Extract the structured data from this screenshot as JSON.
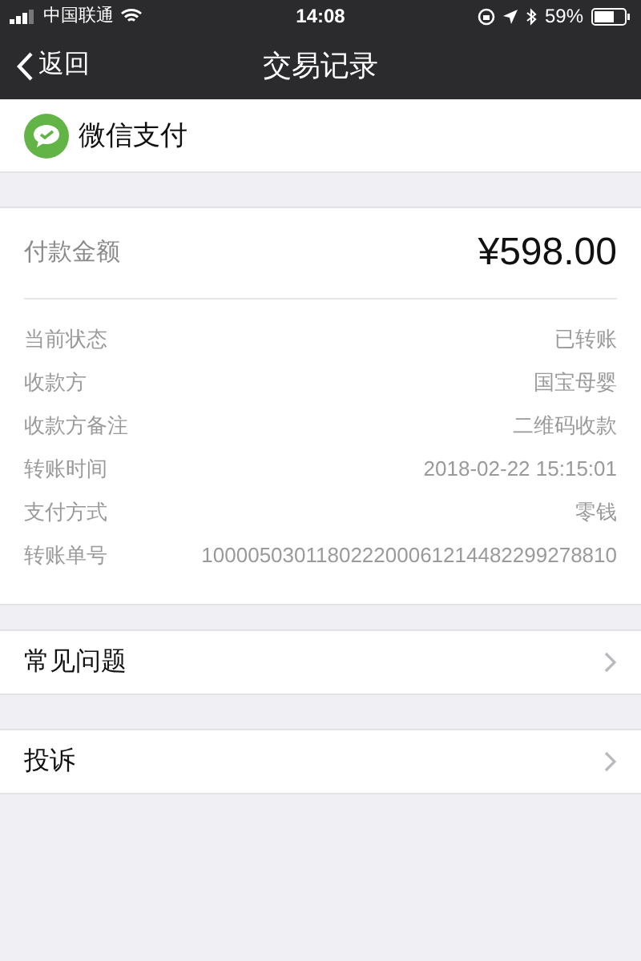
{
  "status_bar": {
    "carrier": "中国联通",
    "time": "14:08",
    "battery": "59%"
  },
  "nav": {
    "back": "返回",
    "title": "交易记录"
  },
  "merchant": {
    "name": "微信支付"
  },
  "amount": {
    "label": "付款金额",
    "value": "¥598.00"
  },
  "details": [
    {
      "label": "当前状态",
      "value": "已转账"
    },
    {
      "label": "收款方",
      "value": "国宝母婴"
    },
    {
      "label": "收款方备注",
      "value": "二维码收款"
    },
    {
      "label": "转账时间",
      "value": "2018-02-22 15:15:01"
    },
    {
      "label": "支付方式",
      "value": "零钱"
    },
    {
      "label": "转账单号",
      "value": "100005030118022200061214482299278810"
    }
  ],
  "links": [
    {
      "label": "常见问题"
    },
    {
      "label": "投诉"
    }
  ]
}
